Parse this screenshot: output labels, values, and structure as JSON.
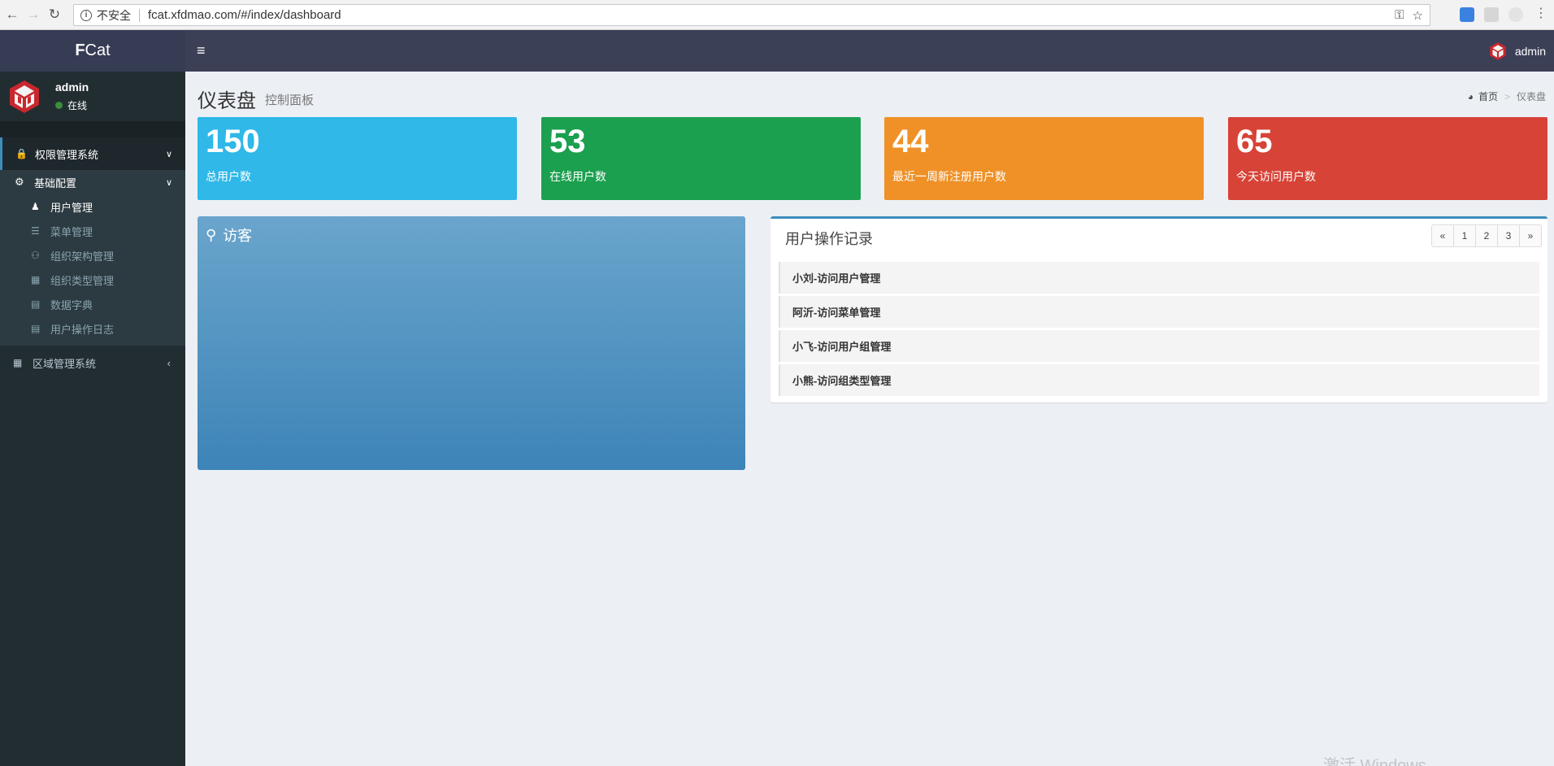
{
  "browser": {
    "insecure_label": "不安全",
    "url": "fcat.xfdmao.com/#/index/dashboard"
  },
  "brand": {
    "bold": "F",
    "rest": "Cat"
  },
  "user": {
    "name": "admin",
    "status": "在线"
  },
  "sidebar": {
    "group1": {
      "label": "权限管理系统"
    },
    "subgroup": {
      "label": "基础配置"
    },
    "items": [
      {
        "label": "用户管理",
        "icon": "user-icon",
        "active": true
      },
      {
        "label": "菜单管理",
        "icon": "list-icon",
        "active": false
      },
      {
        "label": "组织架构管理",
        "icon": "users-icon",
        "active": false
      },
      {
        "label": "组织类型管理",
        "icon": "org-type-icon",
        "active": false
      },
      {
        "label": "数据字典",
        "icon": "book-icon",
        "active": false
      },
      {
        "label": "用户操作日志",
        "icon": "book-icon",
        "active": false
      }
    ],
    "group2": {
      "label": "区域管理系统"
    }
  },
  "topbar": {
    "user": "admin"
  },
  "page": {
    "title": "仪表盘",
    "subtitle": "控制面板",
    "breadcrumb": {
      "home": "首页",
      "sep": ">",
      "current": "仪表盘"
    }
  },
  "stats": [
    {
      "value": "150",
      "label": "总用户数",
      "color": "#2fb8e8"
    },
    {
      "value": "53",
      "label": "在线用户数",
      "color": "#1ba04f"
    },
    {
      "value": "44",
      "label": "最近一周新注册用户数",
      "color": "#ef9127"
    },
    {
      "value": "65",
      "label": "今天访问用户数",
      "color": "#d74337"
    }
  ],
  "visitor": {
    "title": "访客"
  },
  "log": {
    "title": "用户操作记录",
    "pager": [
      "«",
      "1",
      "2",
      "3",
      "»"
    ],
    "items": [
      "小刘-访问用户管理",
      "阿沂-访问菜单管理",
      "小飞-访问用户组管理",
      "小熊-访问组类型管理"
    ]
  },
  "watermark": "激活 Windows",
  "colors": {
    "accent": "#3c8dbc",
    "sidebar": "#222d32",
    "topbar": "#3b4057"
  }
}
